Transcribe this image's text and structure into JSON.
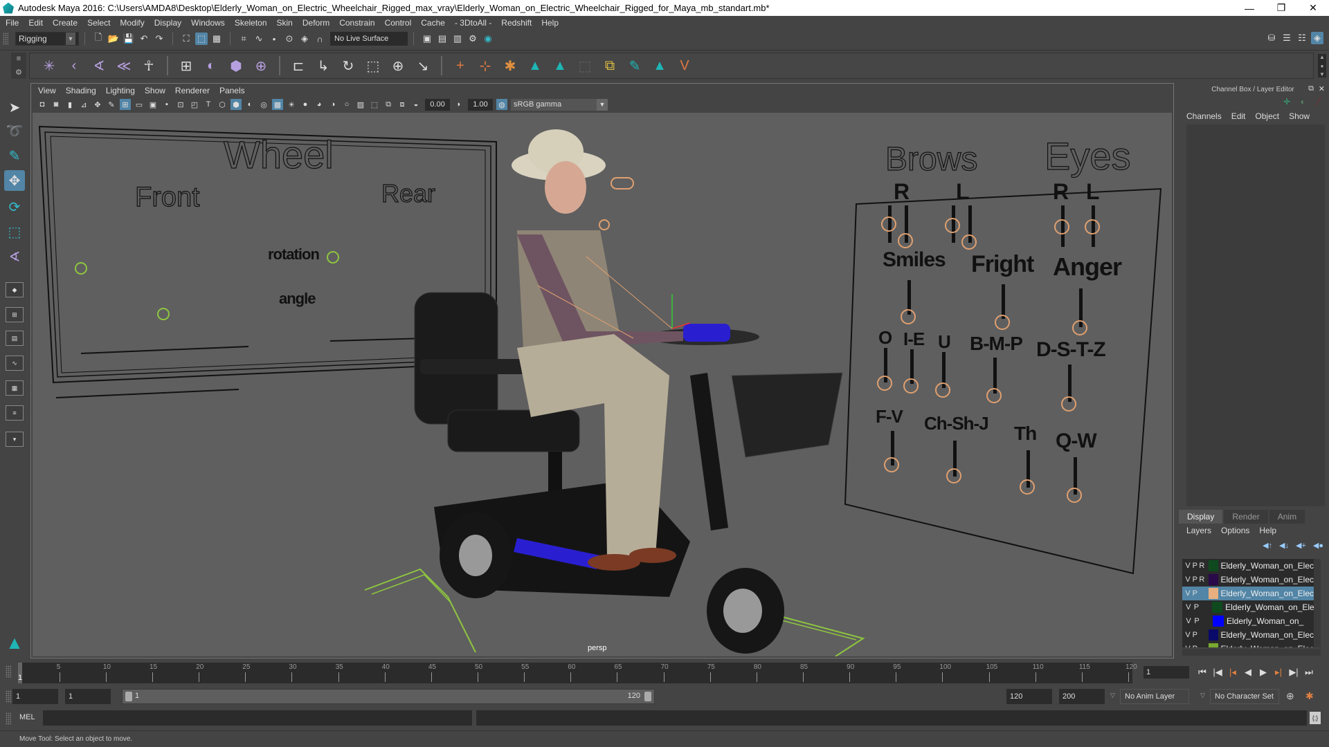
{
  "window": {
    "title": "Autodesk Maya 2016: C:\\Users\\AMDA8\\Desktop\\Elderly_Woman_on_Electric_Wheelchair_Rigged_max_vray\\Elderly_Woman_on_Electric_Wheelchair_Rigged_for_Maya_mb_standart.mb*",
    "minimize": "—",
    "restore": "❐",
    "close": "✕"
  },
  "menubar": [
    "File",
    "Edit",
    "Create",
    "Select",
    "Modify",
    "Display",
    "Windows",
    "Skeleton",
    "Skin",
    "Deform",
    "Constrain",
    "Control",
    "Cache",
    "- 3DtoAll -",
    "Redshift",
    "Help"
  ],
  "statusline": {
    "menuset": "Rigging",
    "live_surface": "No Live Surface"
  },
  "panel": {
    "menu": [
      "View",
      "Shading",
      "Lighting",
      "Show",
      "Renderer",
      "Panels"
    ],
    "toolbar": {
      "exposure": "0.00",
      "gamma": "1.00",
      "color_management": "sRGB gamma"
    },
    "camera_label": "persp"
  },
  "scene": {
    "wheel_board": {
      "title": "Wheel",
      "front": "Front",
      "rear": "Rear",
      "rotation": "rotation",
      "angle": "angle"
    },
    "face_board": {
      "brows": "Brows",
      "eyes": "Eyes",
      "brow_r": "R",
      "brow_l": "L",
      "eye_r": "R",
      "eye_l": "L",
      "smiles": "Smiles",
      "fright": "Fright",
      "anger": "Anger",
      "o": "O",
      "i_e": "I-E",
      "u": "U",
      "b_m_p": "B-M-P",
      "d_s_t_z": "D-S-T-Z",
      "f_v": "F-V",
      "ch_sh_j": "Ch-Sh-J",
      "th": "Th",
      "q_w": "Q-W"
    },
    "colors": {
      "viewport_bg": "#5f5f5f",
      "green_ctrl": "#8ec63f",
      "orange_ctrl": "#e0a070",
      "selection": "#5285a6"
    }
  },
  "channel_box": {
    "title": "Channel Box / Layer Editor",
    "menu": [
      "Channels",
      "Edit",
      "Object",
      "Show"
    ]
  },
  "layer_editor": {
    "tabs": [
      "Display",
      "Render",
      "Anim"
    ],
    "active_tab": "Display",
    "menu": [
      "Layers",
      "Options",
      "Help"
    ],
    "layers": [
      {
        "v": "V",
        "p": "P",
        "r": "R",
        "color": "#0e4a1e",
        "name": "Elderly_Woman_on_Electri",
        "selected": false
      },
      {
        "v": "V",
        "p": "P",
        "r": "R",
        "color": "#2a0a4a",
        "name": "Elderly_Woman_on_Electri",
        "selected": false
      },
      {
        "v": "V",
        "p": "P",
        "r": "",
        "color": "#e8b080",
        "name": "Elderly_Woman_on_Electri",
        "selected": true
      },
      {
        "v": "V",
        "p": "P",
        "r": "",
        "color": "#0e4a1e",
        "name": "Elderly_Woman_on_Elect",
        "selected": false
      },
      {
        "v": "V",
        "p": "P",
        "r": "",
        "color": "#0000ff",
        "name": "Elderly_Woman_on_",
        "selected": false
      },
      {
        "v": "V",
        "p": "P",
        "r": "",
        "color": "#0a0a6a",
        "name": "Elderly_Woman_on_Electri",
        "selected": false
      },
      {
        "v": "V",
        "p": "P",
        "r": "",
        "color": "#7aaa30",
        "name": "Elderly_Woman_on_Electri",
        "selected": false
      }
    ]
  },
  "time_slider": {
    "ticks": [
      1,
      5,
      10,
      15,
      20,
      25,
      30,
      35,
      40,
      45,
      50,
      55,
      60,
      65,
      70,
      75,
      80,
      85,
      90,
      95,
      100,
      105,
      110,
      115,
      120
    ],
    "min": 1,
    "max": 120,
    "current_frame": "1",
    "current_marker": "1"
  },
  "range_slider": {
    "anim_start": "1",
    "playback_start": "1",
    "range_start_label": "1",
    "range_end_label": "120",
    "playback_end": "120",
    "anim_end": "200",
    "anim_layer": "No Anim Layer",
    "character_set": "No Character Set"
  },
  "command_line": {
    "label": "MEL"
  },
  "help_line": {
    "text": "Move Tool: Select an object to move."
  }
}
